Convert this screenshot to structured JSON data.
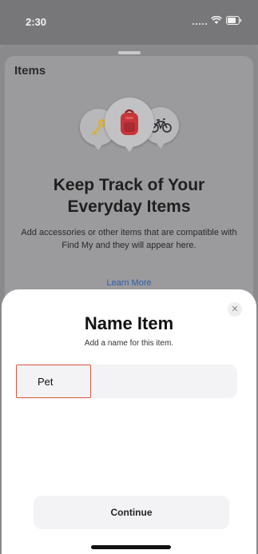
{
  "status_bar": {
    "time": "2:30",
    "icons": [
      "signal-icon",
      "wifi-icon",
      "battery-icon"
    ]
  },
  "background_screen": {
    "title": "Items",
    "illustration_icons": [
      "key-icon",
      "backpack-icon",
      "bicycle-icon"
    ],
    "heading": "Keep Track of Your Everyday Items",
    "body": "Add accessories or other items that are compatible with Find My and they will appear here.",
    "link": "Learn More"
  },
  "modal": {
    "title": "Name Item",
    "subtitle": "Add a name for this item.",
    "name_field": {
      "value": "Pet",
      "placeholder": ""
    },
    "close_icon": "close-icon",
    "continue_label": "Continue"
  },
  "colors": {
    "highlight_border": "#d9553b",
    "link": "#2d5da8",
    "backpack": "#c8353a"
  }
}
